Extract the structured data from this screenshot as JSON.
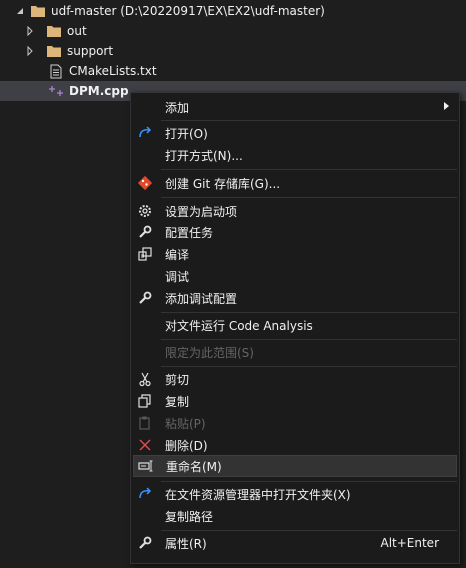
{
  "tree": {
    "root_label": "udf-master (D:\\20220917\\EX\\EX2\\udf-master)",
    "items": [
      {
        "label": "out"
      },
      {
        "label": "support"
      },
      {
        "label": "CMakeLists.txt"
      },
      {
        "label": "DPM.cpp"
      }
    ]
  },
  "menu": {
    "add": "添加",
    "open": "打开(O)",
    "open_with": "打开方式(N)...",
    "create_git": "创建 Git 存储库(G)...",
    "set_startup": "设置为启动项",
    "config_tasks": "配置任务",
    "compile": "编译",
    "debug": "调试",
    "add_debug_config": "添加调试配置",
    "run_code_analysis": "对文件运行 Code Analysis",
    "scope_to_this": "限定为此范围(S)",
    "cut": "剪切",
    "copy": "复制",
    "paste": "粘贴(P)",
    "delete": "删除(D)",
    "rename": "重命名(M)",
    "open_in_explorer": "在文件资源管理器中打开文件夹(X)",
    "copy_path": "复制路径",
    "properties": "属性(R)",
    "properties_shortcut": "Alt+Enter"
  },
  "colors": {
    "folder": "#dcb67a",
    "open_arrow": "#3794ff",
    "delete_x": "#e04a4a",
    "cpp_icon": "#b180d7"
  }
}
